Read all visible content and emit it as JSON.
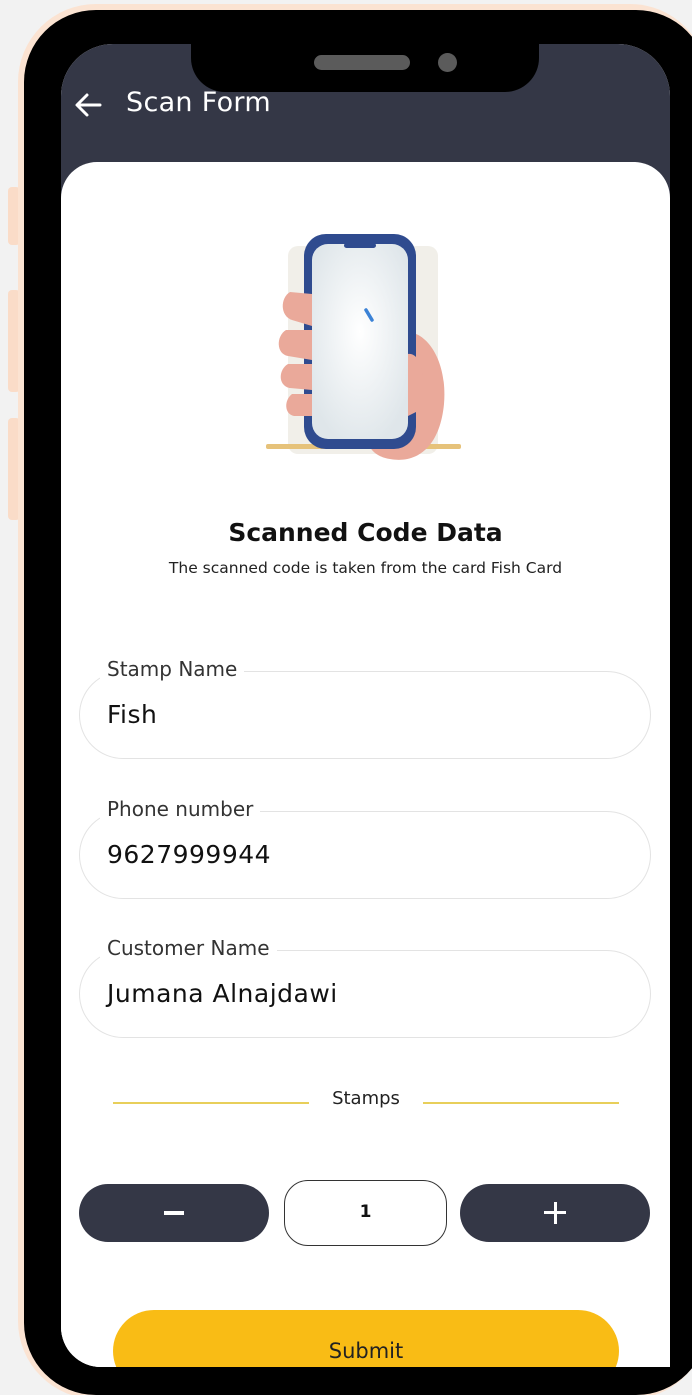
{
  "header": {
    "title": "Scan Form",
    "back_icon": "back-arrow-icon"
  },
  "scan_info": {
    "illustration": "phone-in-hand-scanning-illustration",
    "title": "Scanned Code Data",
    "subtitle": "The scanned code is taken from the card Fish Card"
  },
  "fields": [
    {
      "label": "Stamp Name",
      "value": "Fish"
    },
    {
      "label": "Phone number",
      "value": "9627999944"
    },
    {
      "label": "Customer Name",
      "value": "Jumana Alnajdawi"
    }
  ],
  "stamps": {
    "label": "Stamps",
    "quantity": "1",
    "decrement_icon": "minus-icon",
    "increment_icon": "plus-icon"
  },
  "submit_label": "Submit",
  "colors": {
    "appbar": "#343746",
    "accent": "#f9bc15",
    "divider": "#e8cf5a",
    "phone_rim": "#fbe3d2"
  }
}
